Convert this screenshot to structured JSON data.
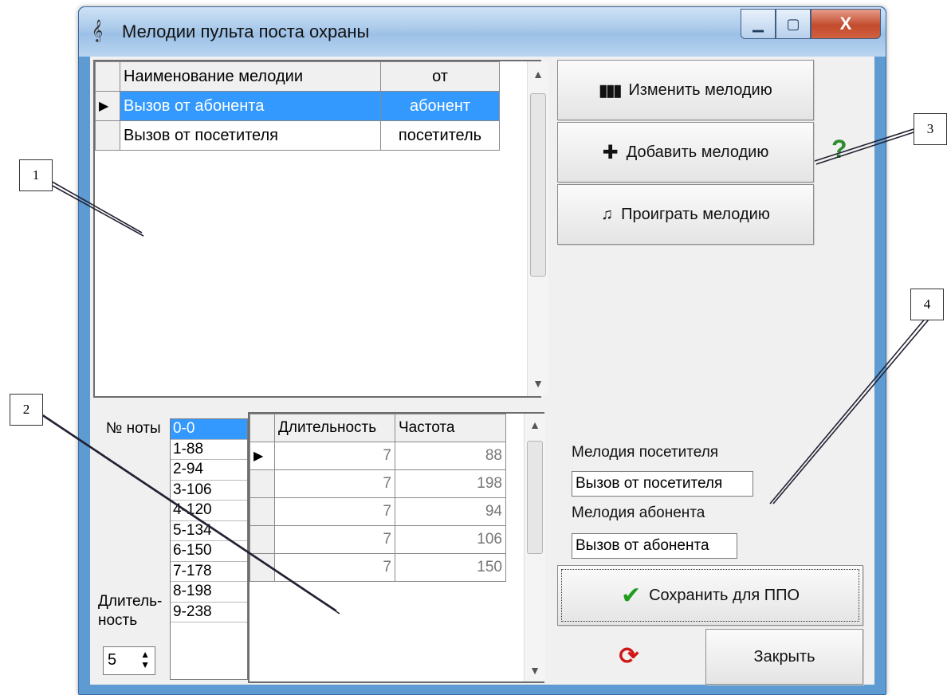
{
  "window": {
    "title": "Мелодии пульта поста охраны",
    "buttons": {
      "minimize": "▁",
      "maximize": "▢",
      "close": "X"
    }
  },
  "melody_grid": {
    "columns": [
      "Наименование мелодии",
      "от"
    ],
    "rows": [
      {
        "name": "Вызов от абонента",
        "from": "абонент",
        "selected": true
      },
      {
        "name": "Вызов от посетителя",
        "from": "посетитель",
        "selected": false
      }
    ]
  },
  "actions": {
    "edit": "Изменить мелодию",
    "add": "Добавить мелодию",
    "play": "Проиграть мелодию",
    "help": "?"
  },
  "notes": {
    "label": "№ ноты",
    "items": [
      "0-0",
      "1-88",
      "2-94",
      "3-106",
      "4-120",
      "5-134",
      "6-150",
      "7-178",
      "8-198",
      "9-238"
    ]
  },
  "duration": {
    "label_line1": "Длитель-",
    "label_line2": "ность",
    "value": "5"
  },
  "note_grid": {
    "columns": [
      "Длительность",
      "Частота"
    ],
    "rows": [
      {
        "duration": "7",
        "frequency": "88"
      },
      {
        "duration": "7",
        "frequency": "198"
      },
      {
        "duration": "7",
        "frequency": "94"
      },
      {
        "duration": "7",
        "frequency": "106"
      },
      {
        "duration": "7",
        "frequency": "150"
      }
    ]
  },
  "assign": {
    "visitor_label": "Мелодия посетителя",
    "visitor_value": "Вызов от посетителя",
    "subscriber_label": "Мелодия абонента",
    "subscriber_value": "Вызов от абонента"
  },
  "footer": {
    "save": "Сохранить для ППО",
    "close": "Закрыть"
  },
  "callouts": [
    "1",
    "2",
    "3",
    "4"
  ],
  "colors": {
    "selection": "#3399ff",
    "help": "#2e8b2e",
    "save_check": "#1f9b1f",
    "refresh": "#d01818"
  }
}
